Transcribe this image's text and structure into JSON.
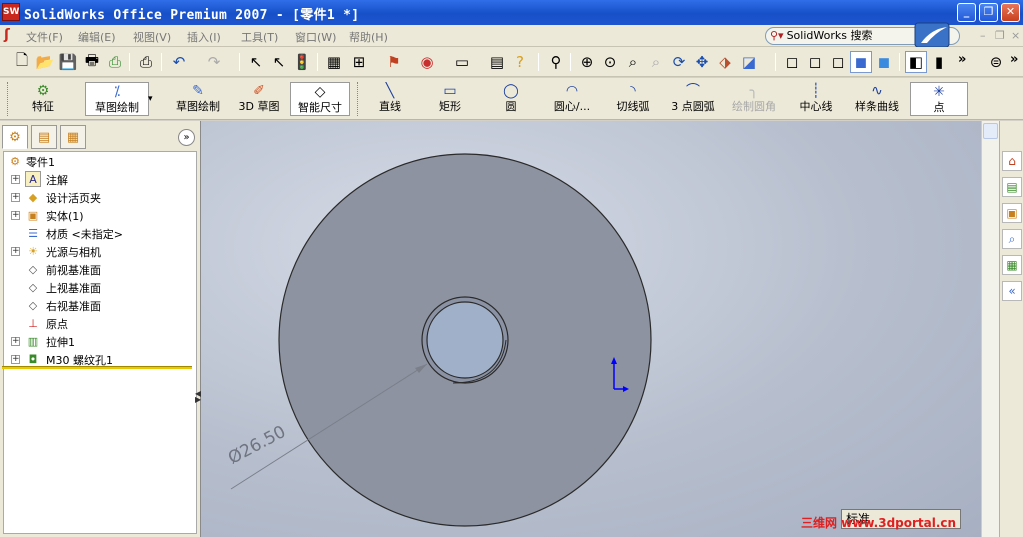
{
  "titlebar": {
    "app_icon": "SW",
    "title": "SolidWorks Office Premium 2007 - [零件1 *]",
    "min": "_",
    "restore": "❐",
    "close": "✕"
  },
  "menu": {
    "items": [
      "文件(F)",
      "编辑(E)",
      "视图(V)",
      "插入(I)",
      "工具(T)",
      "窗口(W)",
      "帮助(H)"
    ],
    "search": {
      "label": "SolidWorks 搜索",
      "icon": "search-icon"
    }
  },
  "toolbar": {
    "tools": [
      "new-file-icon",
      "open-file-icon",
      "save-icon",
      "print-icon",
      "undo-icon",
      "redo-icon",
      "select-icon",
      "rebuild-icon",
      "options-icon",
      "zoom-to-fit-icon",
      "zoom-area-icon",
      "zoom-in-out-icon",
      "rotate-icon",
      "pan-icon",
      "view-orientation-icon",
      "wireframe-icon",
      "hidden-lines-icon",
      "shaded-icon"
    ],
    "chevron": "»"
  },
  "command_manager": {
    "commands": [
      {
        "label": "特征",
        "icon": "feature-icon"
      },
      {
        "label": "草图绘制",
        "icon": "sketch-icon"
      },
      {
        "label": "草图绘制",
        "icon": "sketch-icon"
      },
      {
        "label": "3D 草图",
        "icon": "3d-sketch-icon"
      },
      {
        "label": "智能尺寸",
        "icon": "smart-dimension-icon"
      },
      {
        "label": "直线",
        "icon": "line-icon"
      },
      {
        "label": "矩形",
        "icon": "rectangle-icon"
      },
      {
        "label": "圆",
        "icon": "circle-icon"
      },
      {
        "label": "圆心/...",
        "icon": "centerpoint-arc-icon"
      },
      {
        "label": "切线弧",
        "icon": "tangent-arc-icon"
      },
      {
        "label": "3 点圆弧",
        "icon": "three-point-arc-icon"
      },
      {
        "label": "绘制圆角",
        "icon": "sketch-fillet-icon"
      },
      {
        "label": "中心线",
        "icon": "centerline-icon"
      },
      {
        "label": "样条曲线",
        "icon": "spline-icon"
      },
      {
        "label": "点",
        "icon": "point-icon"
      }
    ]
  },
  "feature_tree": {
    "root": "零件1",
    "nodes": [
      {
        "label": "注解",
        "icon": "annotation-icon",
        "expand": "+"
      },
      {
        "label": "设计活页夹",
        "icon": "design-binder-icon",
        "expand": "+"
      },
      {
        "label": "实体(1)",
        "icon": "solid-body-icon",
        "expand": "+"
      },
      {
        "label": "材质 <未指定>",
        "icon": "material-icon",
        "expand": ""
      },
      {
        "label": "光源与相机",
        "icon": "lights-camera-icon",
        "expand": "+"
      },
      {
        "label": "前视基准面",
        "icon": "plane-icon",
        "expand": ""
      },
      {
        "label": "上视基准面",
        "icon": "plane-icon",
        "expand": ""
      },
      {
        "label": "右视基准面",
        "icon": "plane-icon",
        "expand": ""
      },
      {
        "label": "原点",
        "icon": "origin-icon",
        "expand": ""
      },
      {
        "label": "拉伸1",
        "icon": "extrude-icon",
        "expand": "+"
      },
      {
        "label": "M30 螺纹孔1",
        "icon": "hole-icon",
        "expand": "+"
      }
    ]
  },
  "graphics": {
    "dimension_text": "Ø26.50",
    "status_box": "标准",
    "watermark": "三维网 www.3dportal.cn"
  },
  "colors": {
    "title_blue": "#1e55cf",
    "rollback_yellow": "#e8c800",
    "origin_blue": "#0000ff",
    "part_gray": "#8d93a0"
  }
}
